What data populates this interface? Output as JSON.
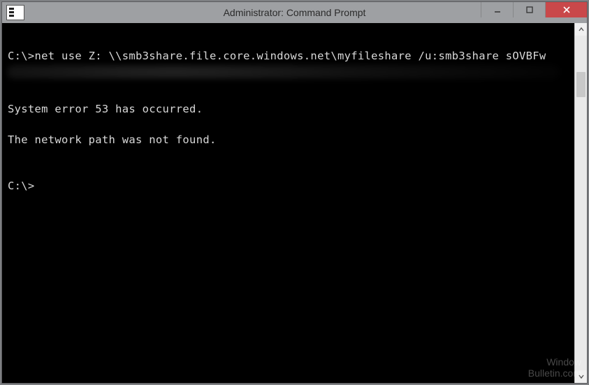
{
  "window": {
    "title": "Administrator: Command Prompt"
  },
  "terminal": {
    "prompt1": "C:\\>",
    "command": "net use Z: \\\\smb3share.file.core.windows.net\\myfileshare /u:smb3share sOVBFw",
    "error_line1": "System error 53 has occurred.",
    "error_line2": "The network path was not found.",
    "prompt2": "C:\\>"
  },
  "watermark": {
    "line1": "Window",
    "line2": "Bulletin.com"
  }
}
